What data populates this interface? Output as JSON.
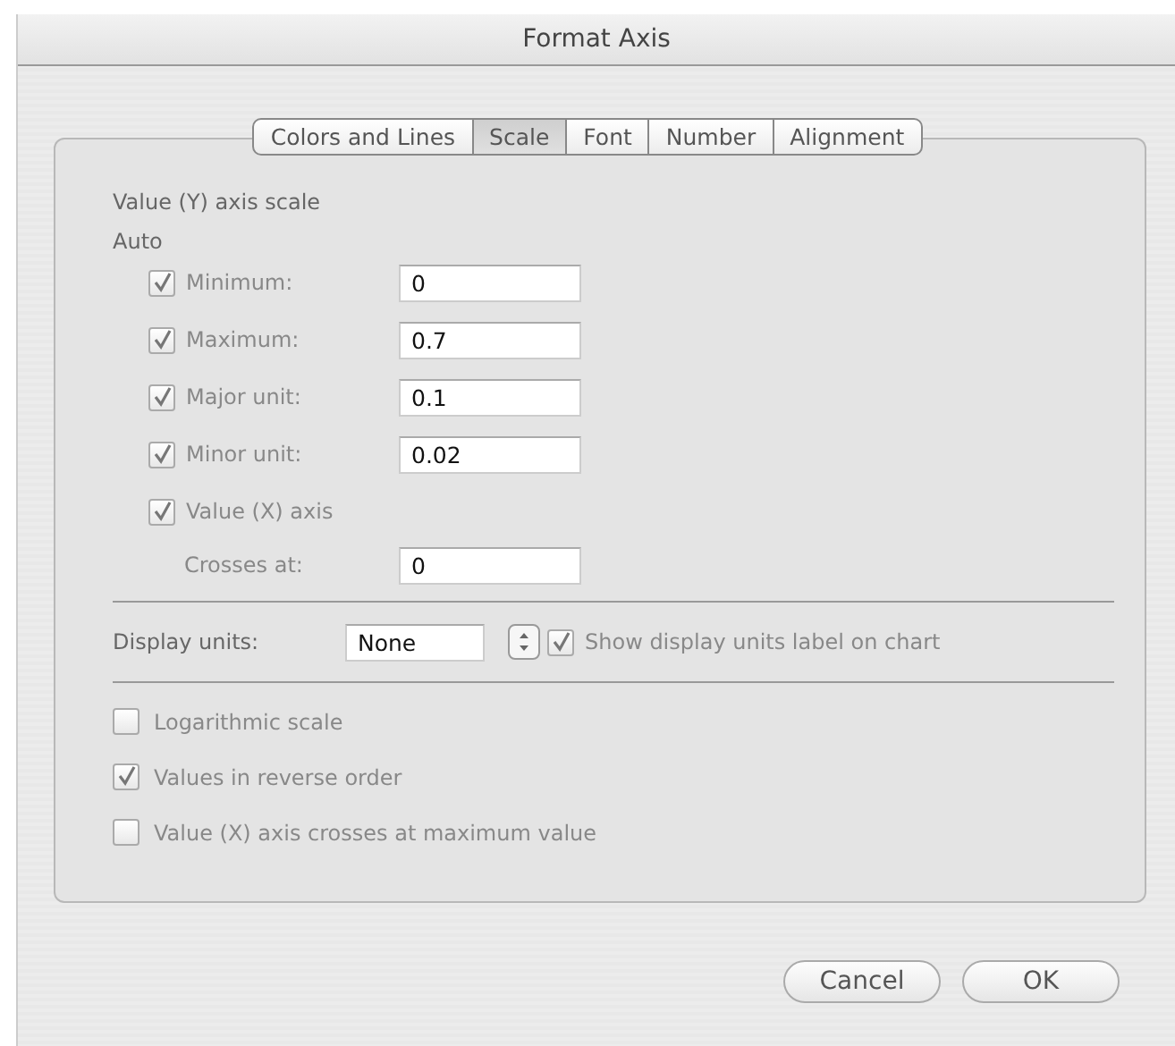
{
  "window": {
    "title": "Format Axis"
  },
  "tabs": [
    {
      "label": "Colors and Lines",
      "selected": false
    },
    {
      "label": "Scale",
      "selected": true
    },
    {
      "label": "Font",
      "selected": false
    },
    {
      "label": "Number",
      "selected": false
    },
    {
      "label": "Alignment",
      "selected": false
    }
  ],
  "section_title": "Value (Y) axis scale",
  "auto_label": "Auto",
  "scale_rows": [
    {
      "label": "Minimum:",
      "checked": true,
      "value": "0"
    },
    {
      "label": "Maximum:",
      "checked": true,
      "value": "0.7"
    },
    {
      "label": "Major unit:",
      "checked": true,
      "value": "0.1"
    },
    {
      "label": "Minor unit:",
      "checked": true,
      "value": "0.02"
    }
  ],
  "cross_axis": {
    "label": "Value (X) axis",
    "checked": true,
    "crosses_label": "Crosses at:",
    "value": "0"
  },
  "display_units": {
    "label": "Display units:",
    "value": "None",
    "show_label": {
      "label": "Show display units label on chart",
      "checked": true
    }
  },
  "options": [
    {
      "label": "Logarithmic scale",
      "checked": false
    },
    {
      "label": "Values in reverse order",
      "checked": true
    },
    {
      "label": "Value (X) axis crosses at maximum value",
      "checked": false
    }
  ],
  "buttons": [
    "Cancel",
    "OK"
  ]
}
